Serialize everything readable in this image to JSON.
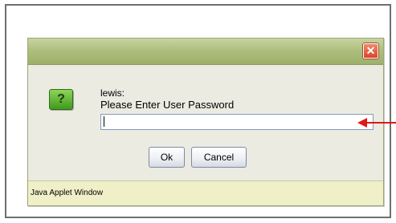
{
  "dialog": {
    "close_symbol": "✕",
    "icon": "question-icon",
    "icon_glyph": "?",
    "user_label": "lewis:",
    "prompt_label": "Please Enter User Password",
    "password_value": "",
    "ok_label": "Ok",
    "cancel_label": "Cancel",
    "status_text": "Java Applet Window"
  },
  "annotation": {
    "arrow_color": "#e01818"
  },
  "colors": {
    "titlebar": "#aebf7d",
    "statusbar": "#efefc8",
    "close_button": "#d8452a",
    "question_icon": "#3f9a1e"
  }
}
